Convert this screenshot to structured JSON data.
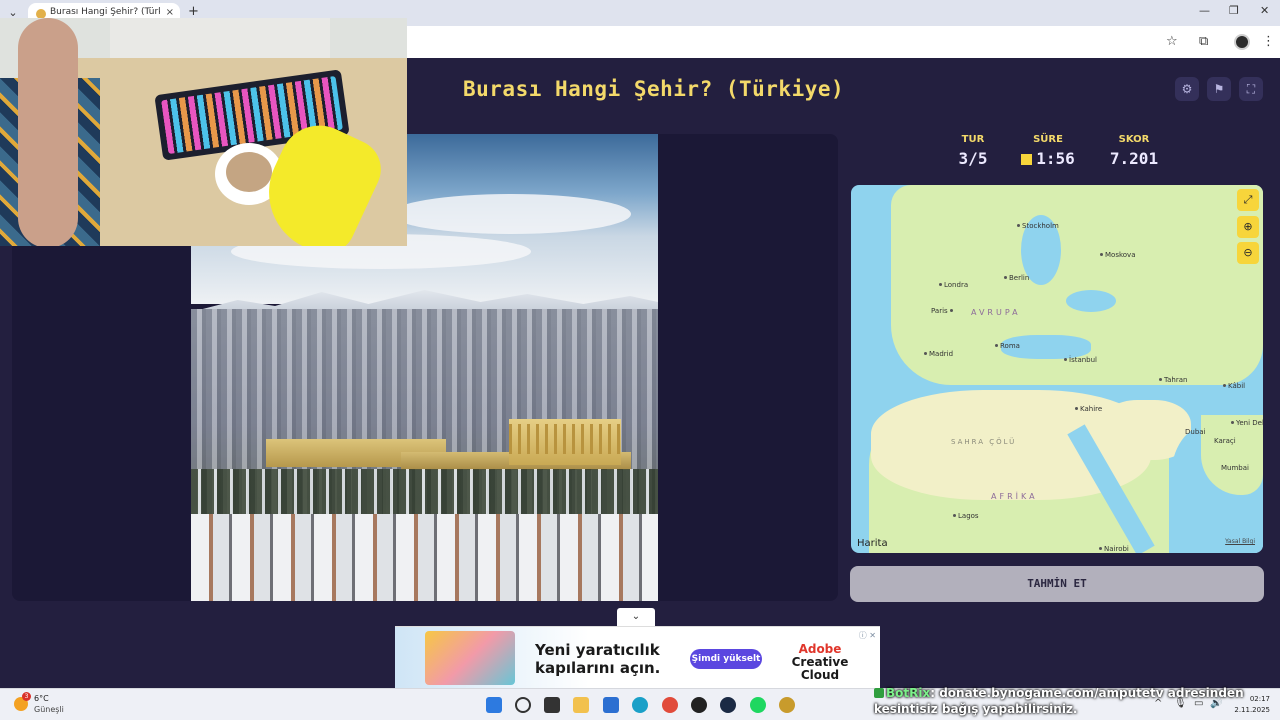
{
  "browser": {
    "tab_title": "Burası Hangi Şehir? (Türkiye) - ",
    "tab_close": "×",
    "new_tab": "+",
    "tab_dropdown": "⌄",
    "minimize": "—",
    "restore": "❐",
    "close": "✕",
    "star": "☆",
    "extensions": "⧉",
    "menu": "⋮"
  },
  "header": {
    "title": "Burası Hangi Şehir? (Türkiye)",
    "settings_icon": "⚙",
    "flag_icon": "⚑",
    "fullscreen_icon": "⛶"
  },
  "stats": {
    "round_label": "TUR",
    "round_value": "3/5",
    "time_label": "SÜRE",
    "time_value": "1:56",
    "score_label": "SKOR",
    "score_value": "7.201"
  },
  "map": {
    "expand_icon": "⤢",
    "zoom_in_icon": "⊕",
    "zoom_out_icon": "⊖",
    "brand": " Harita",
    "legal": "Yasal Bilgi",
    "regions": {
      "europe": "AVRUPA",
      "africa": "AFRİKA",
      "sahara": "SAHRA ÇÖLÜ"
    },
    "cities": {
      "stockholm": "Stockholm",
      "moskova": "Moskova",
      "berlin": "Berlin",
      "londra": "Londra",
      "paris": "Paris",
      "madrid": "Madrid",
      "roma": "Roma",
      "istanbul": "İstanbul",
      "tahran": "Tahran",
      "kabil": "Kâbil",
      "kahire": "Kahire",
      "dubai": "Dubai",
      "karaci": "Karaçi",
      "yeni_delhi": "Yeni Del",
      "mumbai": "Mumbai",
      "lagos": "Lagos",
      "nairobi": "Nairobi"
    }
  },
  "guess_button": "TAHMİN ET",
  "collapse_icon": "⌄",
  "ad": {
    "headline": "Yeni yaratıcılık kapılarını açın.",
    "cta": "Şimdi yükselt",
    "brand_top": "Adobe",
    "brand_bottom": "Creative Cloud",
    "info": "ⓘ ✕"
  },
  "taskbar": {
    "weather_temp": "6°C",
    "weather_desc": "Güneşli",
    "weather_badge": "3",
    "clock_time": "02:17",
    "clock_date": "2.11.2025",
    "tray_chevron": "^",
    "tray_mic": "🎙",
    "tray_net": "▭",
    "tray_vol": "🔊"
  },
  "chat": {
    "user": "BotRix",
    "message": ": donate.bynogame.com/amputetv adresinden kesintisiz bağış yapabilirsiniz."
  },
  "colors": {
    "accent": "#f3d96a",
    "page_bg": "#231f3f",
    "timer_square": "#f7d53b"
  }
}
